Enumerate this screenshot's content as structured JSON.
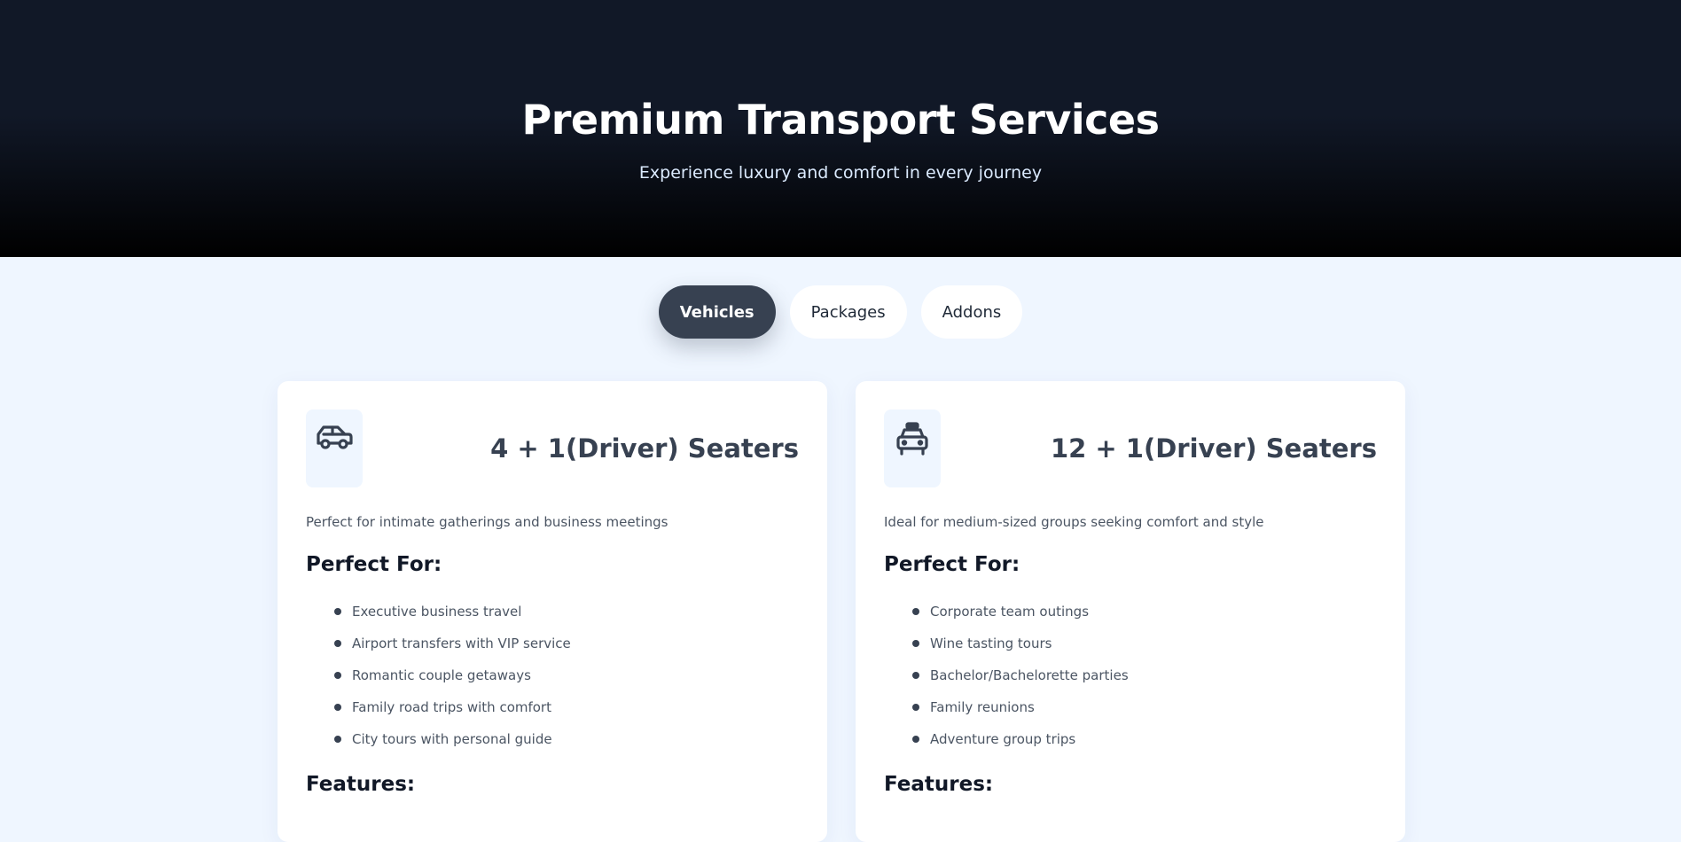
{
  "hero": {
    "title": "Premium Transport Services",
    "subtitle": "Experience luxury and comfort in every journey"
  },
  "tabs": [
    {
      "label": "Vehicles",
      "active": true
    },
    {
      "label": "Packages",
      "active": false
    },
    {
      "label": "Addons",
      "active": false
    }
  ],
  "cards": [
    {
      "icon": "car-icon",
      "title": "4 + 1(Driver) Seaters",
      "description": "Perfect for intimate gatherings and business meetings",
      "perfect_for_heading": "Perfect For:",
      "perfect_for": [
        "Executive business travel",
        "Airport transfers with VIP service",
        "Romantic couple getaways",
        "Family road trips with comfort",
        "City tours with personal guide"
      ],
      "features_heading": "Features:"
    },
    {
      "icon": "taxi-icon",
      "title": "12 + 1(Driver) Seaters",
      "description": "Ideal for medium-sized groups seeking comfort and style",
      "perfect_for_heading": "Perfect For:",
      "perfect_for": [
        "Corporate team outings",
        "Wine tasting tours",
        "Bachelor/Bachelorette parties",
        "Family reunions",
        "Adventure group trips"
      ],
      "features_heading": "Features:"
    }
  ],
  "colors": {
    "hero_bg": "#111827",
    "accent": "#374151",
    "page_bg": "#eff6ff"
  }
}
